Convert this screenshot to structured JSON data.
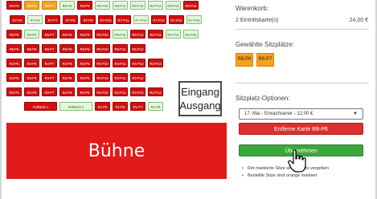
{
  "seat_rows": [
    {
      "seats": [
        {
          "label": "R9-P9",
          "color": "red"
        },
        {
          "label": "R8-P6",
          "color": "orange"
        },
        {
          "label": "R8-P7",
          "color": "orange"
        },
        {
          "label": "R8-P8",
          "color": "green"
        },
        {
          "label": "R8-P9",
          "color": "red"
        },
        {
          "label": "R8-P10",
          "color": "green"
        },
        {
          "label": "R8-P11",
          "color": "green"
        },
        {
          "label": "R8-P12",
          "color": "green"
        },
        {
          "label": "R8-P13",
          "color": "green"
        },
        {
          "label": "R8-P14",
          "color": "green"
        },
        {
          "label": "R8-P15",
          "color": "red"
        }
      ]
    },
    {
      "seats": [
        {
          "label": "R7-P5",
          "color": "red"
        },
        {
          "label": "R7-P6",
          "color": "green"
        },
        {
          "label": "R7-P7",
          "color": "red"
        },
        {
          "label": "R7-P8",
          "color": "red"
        },
        {
          "label": "R7-P9",
          "color": "red"
        },
        {
          "label": "R7-P10",
          "color": "red"
        },
        {
          "label": "R7-P11",
          "color": "red"
        },
        {
          "label": "R7-P12",
          "color": "green"
        },
        {
          "label": "R7-P13",
          "color": "red"
        },
        {
          "label": "R7-P14",
          "color": "red"
        },
        {
          "label": "R7-P15",
          "color": "green"
        }
      ]
    },
    {
      "seats": [
        {
          "label": "R6-P5",
          "color": "red"
        },
        {
          "label": "R6-P6",
          "color": "green"
        },
        {
          "label": "R6-P7",
          "color": "red"
        },
        {
          "label": "R6-P8",
          "color": "red"
        },
        {
          "label": "R6-P9",
          "color": "red"
        },
        {
          "label": "R6-P10",
          "color": "red"
        },
        {
          "label": "R6-P11",
          "color": "green"
        },
        {
          "label": "R6-P12",
          "color": "red"
        },
        {
          "label": "R6-P13",
          "color": "red"
        },
        {
          "label": "R6-P14",
          "color": "green"
        },
        {
          "label": "R6-P15",
          "color": "green"
        }
      ]
    },
    {
      "seats": [
        {
          "label": "R5-P5",
          "color": "red"
        },
        {
          "label": "R5-P6",
          "color": "red"
        },
        {
          "label": "R5-P7",
          "color": "red"
        },
        {
          "label": "R5-P8",
          "color": "red"
        },
        {
          "label": "R5-P9",
          "color": "red"
        },
        {
          "label": "R5-P10",
          "color": "red"
        },
        {
          "label": "R5-P11",
          "color": "red"
        },
        {
          "label": "R5-P12",
          "color": "red"
        }
      ]
    },
    {
      "seats": [
        {
          "label": "R4-P5",
          "color": "red"
        },
        {
          "label": "R4-P6",
          "color": "red"
        },
        {
          "label": "R4-P7",
          "color": "red"
        },
        {
          "label": "R4-P8",
          "color": "red"
        },
        {
          "label": "R4-P9",
          "color": "red"
        },
        {
          "label": "R4-P10",
          "color": "red"
        },
        {
          "label": "R4-P11",
          "color": "red"
        },
        {
          "label": "R4-P12",
          "color": "red"
        },
        {
          "label": "R4-P13",
          "color": "red"
        }
      ]
    },
    {
      "seats": [
        {
          "label": "R3-P5",
          "color": "red"
        },
        {
          "label": "R3-P6",
          "color": "red"
        },
        {
          "label": "R3-P7",
          "color": "red"
        },
        {
          "label": "R3-P8",
          "color": "red"
        },
        {
          "label": "R3-P9",
          "color": "red"
        },
        {
          "label": "R3-P10",
          "color": "red"
        },
        {
          "label": "R3-P11",
          "color": "red"
        },
        {
          "label": "R3-P12",
          "color": "red"
        }
      ]
    },
    {
      "seats": [
        {
          "label": "R2-P5",
          "color": "red"
        },
        {
          "label": "R2-P6",
          "color": "red"
        },
        {
          "label": "R2-P7",
          "color": "red"
        },
        {
          "label": "R2-P8",
          "color": "red"
        },
        {
          "label": "R2-P9",
          "color": "red"
        },
        {
          "label": "R2-P10",
          "color": "red"
        },
        {
          "label": "R2-P11",
          "color": "red"
        },
        {
          "label": "R2-P12",
          "color": "red"
        },
        {
          "label": "R2-P13",
          "color": "red"
        }
      ]
    },
    {
      "seats": [
        {
          "label": "Rollstuhl 1",
          "color": "red"
        },
        {
          "label": "Rollstuhl 2",
          "color": "green"
        },
        {
          "label": "R1-P5",
          "color": "red"
        },
        {
          "label": "R1-P6",
          "color": "red"
        },
        {
          "label": "R1-P7",
          "color": "red"
        },
        {
          "label": "R1-P8",
          "color": "green"
        }
      ]
    }
  ],
  "entrance": {
    "line1": "Eingang",
    "line2": "Ausgang"
  },
  "stage": {
    "label": "Bühne"
  },
  "sidebar": {
    "cart_title": "Warenkorb:",
    "cart_item": "2 Eintrittskarte(n)",
    "cart_price": "24,00 €",
    "selected_title": "Gewählte Sitzplätze:",
    "selected_seats": [
      "R8-P6",
      "R8-P7"
    ],
    "options_title": "Sitzplatz-Optionen:",
    "option_selected": "17. Mai - Erwachsener - 12,00 €",
    "remove_button": "Entferne Karte R8-P6",
    "apply_button": "Übernehmen",
    "legend": [
      "Rot markierte Sitze sind bereits vergeben",
      "Bestellte Sitze sind orange markiert"
    ]
  },
  "colors": {
    "seat_red": "#d01010",
    "seat_green": "#e6f7e0",
    "seat_orange": "#f5a21b",
    "stage": "#e11a1a",
    "apply": "#3da63d",
    "remove": "#dc3030"
  }
}
